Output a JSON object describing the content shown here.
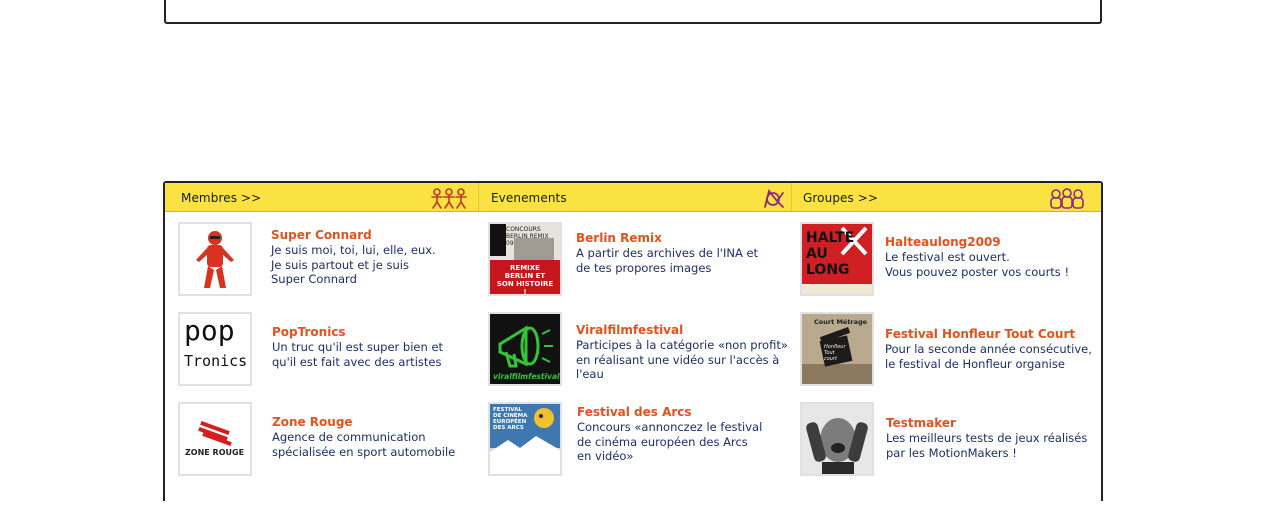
{
  "panel": {
    "columns": [
      {
        "header": "Membres >>",
        "icon": "people-icon",
        "items": [
          {
            "title": "Super Connard",
            "desc": [
              "Je suis moi, toi, lui, elle, eux.",
              "Je suis partout et je suis",
              "Super Connard"
            ]
          },
          {
            "title": "PopTronics",
            "desc": [
              "Un truc qu'il est super bien et",
              "qu'il est fait avec des artistes"
            ]
          },
          {
            "title": "Zone Rouge",
            "desc": [
              "Agence de communication",
              "spécialisée en sport automobile"
            ]
          }
        ]
      },
      {
        "header": "Evenements",
        "icon": "event-icon",
        "items": [
          {
            "title": "Berlin Remix",
            "desc": [
              "A partir des archives de l'INA et",
              "de tes propores images"
            ]
          },
          {
            "title": "Viralfilmfestival",
            "desc": [
              "Participes à la catégorie «non profit»",
              "en réalisant une vidéo sur l'accès à",
              "l'eau"
            ]
          },
          {
            "title": "Festival des Arcs",
            "desc": [
              "Concours «annonczez le festival",
              "de cinéma européen des Arcs",
              "en vidéo»"
            ]
          }
        ]
      },
      {
        "header": "Groupes >>",
        "icon": "group-icon",
        "items": [
          {
            "title": "Halteaulong2009",
            "desc": [
              "Le festival est ouvert.",
              "Vous pouvez poster vos courts !"
            ]
          },
          {
            "title": "Festival Honfleur Tout Court",
            "desc": [
              "Pour la seconde année consécutive,",
              "le festival de Honfleur organise"
            ]
          },
          {
            "title": "Testmaker",
            "desc": [
              "Les meilleurs tests de jeux réalisés",
              "par les MotionMakers !"
            ]
          }
        ]
      }
    ]
  },
  "thumb_text": {
    "poptronics_top": "pop",
    "poptronics_bottom": "Tronics",
    "zonerouge": "ZONE ROUGE",
    "berlin_top": "CONCOURS BERLIN REMIX 09",
    "berlin_banner": "REMIXE BERLIN ET SON HISTOIRE !",
    "viral_caption": "viralfilmfestival",
    "arcs_caption": "FESTIVAL DE CINÉMA EUROPÉEN DES ARCS",
    "halte": "HALTE AU LONG",
    "honfleur_caption": "Court Métrage",
    "honfleur_board": "Honfleur Tout court"
  },
  "colors": {
    "header_bg": "#fbe243",
    "title_orange": "#e3521c",
    "desc_blue": "#1d2e6a",
    "icon_red": "#c0392b",
    "icon_purple": "#8e2a7a"
  }
}
